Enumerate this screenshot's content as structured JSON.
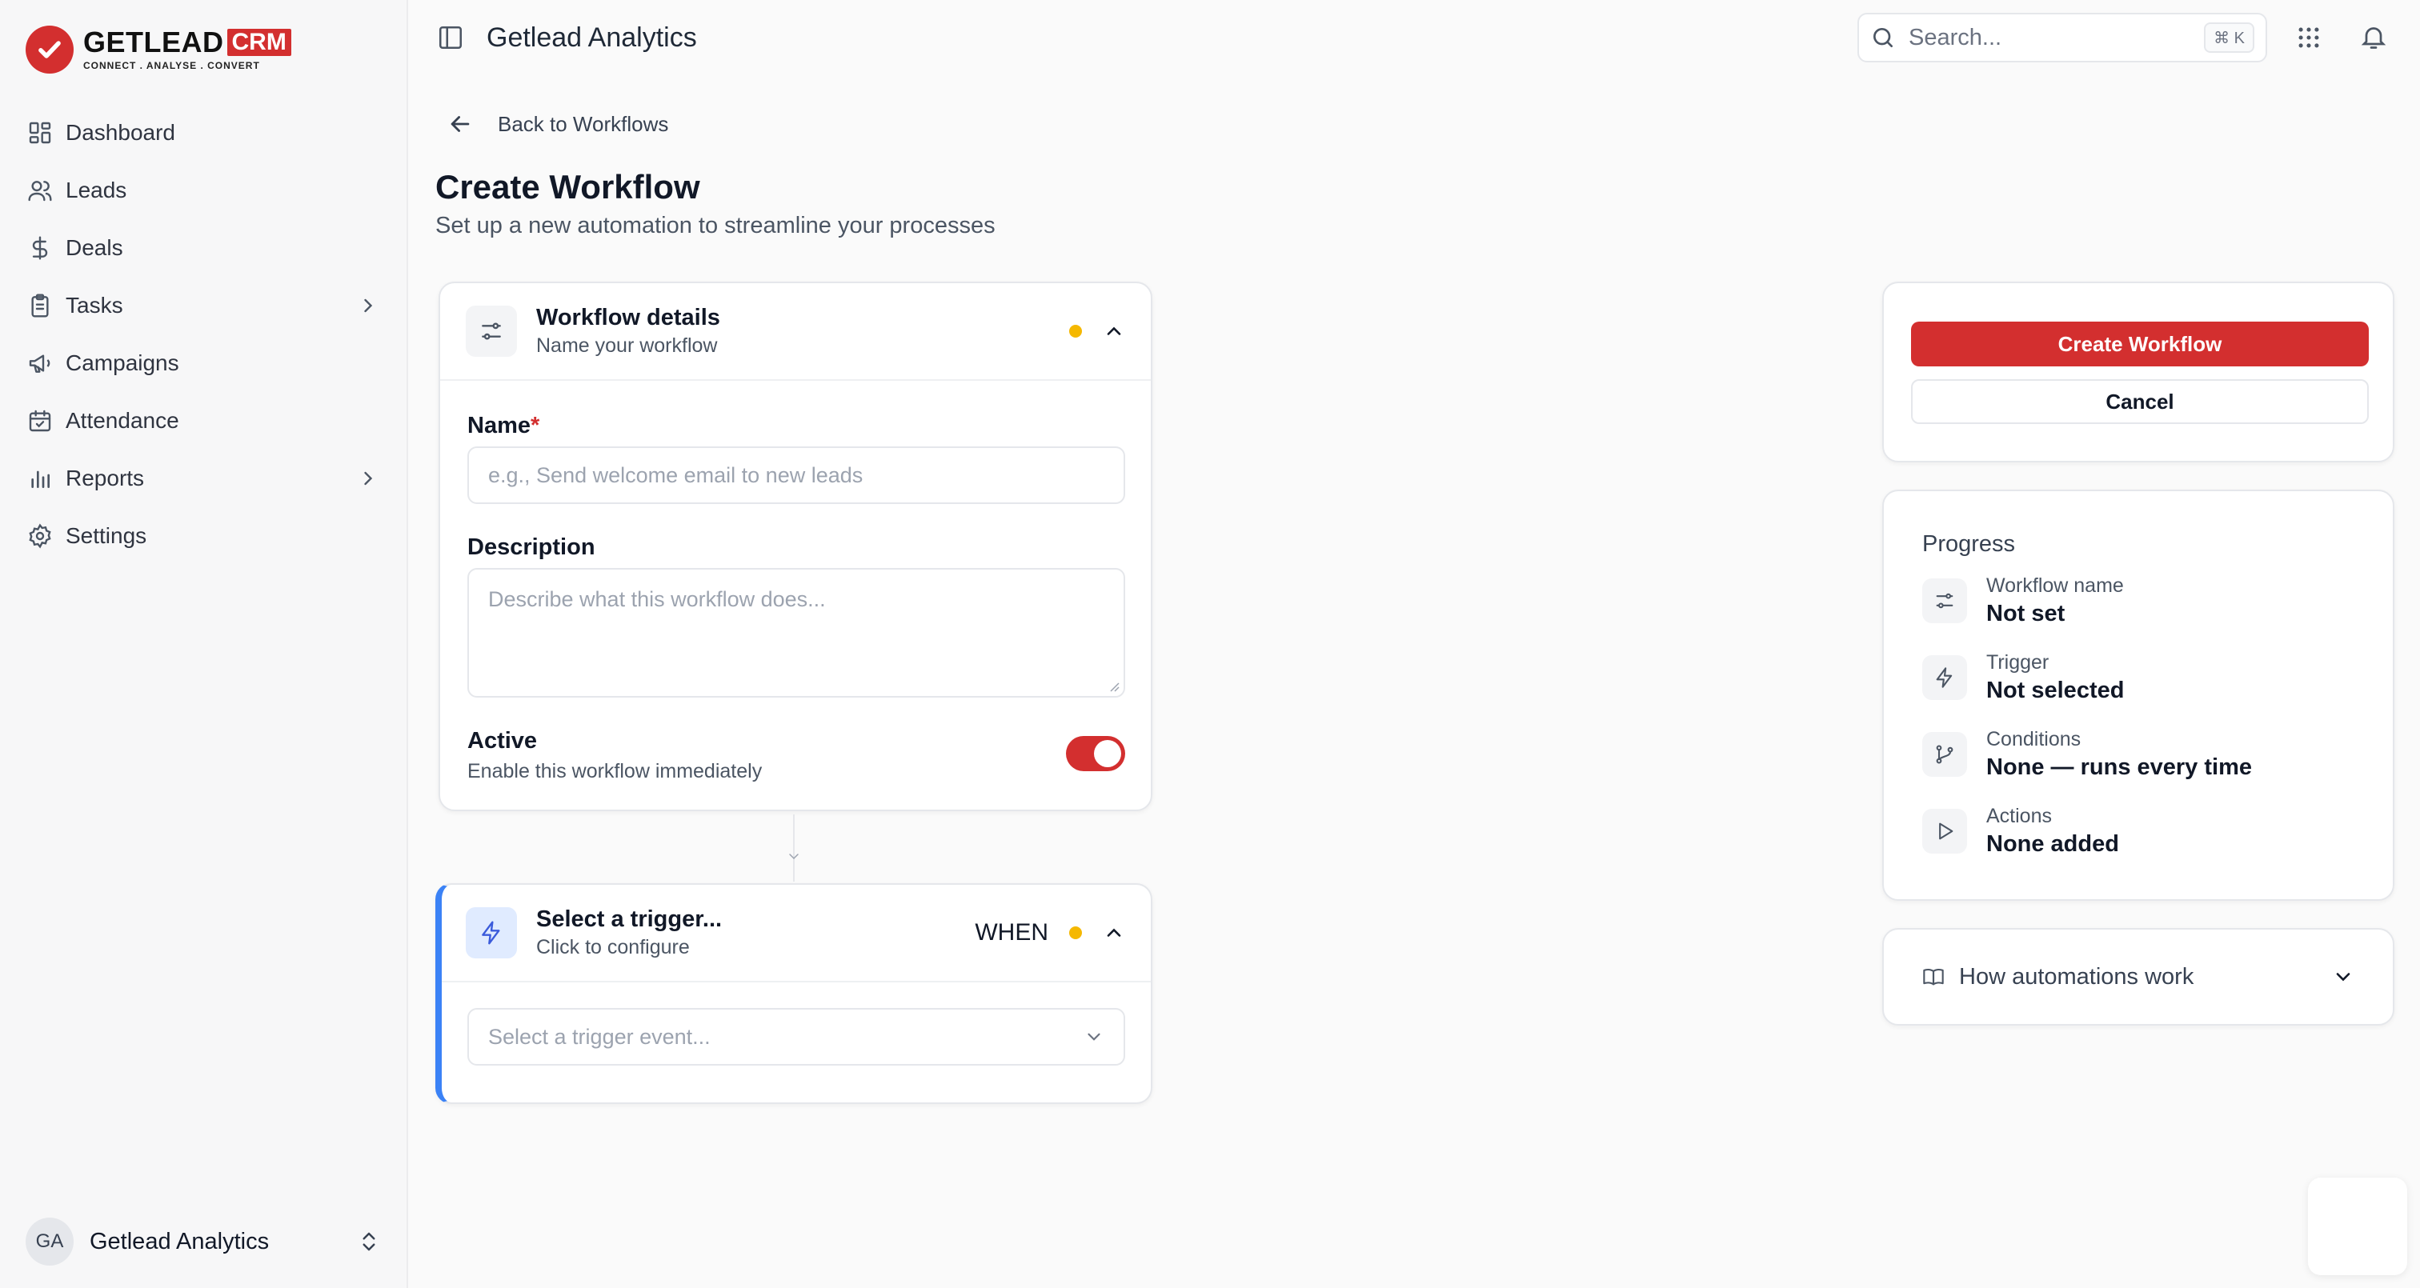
{
  "brand": {
    "name": "GETLEAD",
    "badge": "CRM",
    "tagline": "CONNECT . ANALYSE . CONVERT",
    "color": "#d32f2f"
  },
  "sidebar": {
    "items": [
      {
        "label": "Dashboard",
        "icon": "grid-icon"
      },
      {
        "label": "Leads",
        "icon": "users-icon"
      },
      {
        "label": "Deals",
        "icon": "dollar-icon"
      },
      {
        "label": "Tasks",
        "icon": "clipboard-icon",
        "expandable": true
      },
      {
        "label": "Campaigns",
        "icon": "megaphone-icon"
      },
      {
        "label": "Attendance",
        "icon": "calendar-check-icon"
      },
      {
        "label": "Reports",
        "icon": "bar-chart-icon",
        "expandable": true
      },
      {
        "label": "Settings",
        "icon": "gear-icon"
      }
    ],
    "account": {
      "initials": "GA",
      "name": "Getlead Analytics"
    }
  },
  "topbar": {
    "title": "Getlead Analytics",
    "search_placeholder": "Search...",
    "search_shortcut": "⌘ K"
  },
  "main": {
    "back_label": "Back to Workflows",
    "title": "Create Workflow",
    "subtitle": "Set up a new automation to streamline your processes",
    "details_card": {
      "title": "Workflow details",
      "subtitle": "Name your workflow",
      "name_label": "Name",
      "name_required": "*",
      "name_placeholder": "e.g., Send welcome email to new leads",
      "description_label": "Description",
      "description_placeholder": "Describe what this workflow does...",
      "active_label": "Active",
      "active_sub": "Enable this workflow immediately",
      "active_on": true
    },
    "trigger_card": {
      "title": "Select a trigger...",
      "subtitle": "Click to configure",
      "badge": "WHEN",
      "select_placeholder": "Select a trigger event...",
      "accent": "#3b82f6"
    }
  },
  "actions": {
    "create_label": "Create Workflow",
    "cancel_label": "Cancel"
  },
  "progress": {
    "title": "Progress",
    "items": [
      {
        "label": "Workflow name",
        "value": "Not set",
        "icon": "sliders-icon"
      },
      {
        "label": "Trigger",
        "value": "Not selected",
        "icon": "lightning-icon"
      },
      {
        "label": "Conditions",
        "value": "None — runs every time",
        "icon": "branch-icon"
      },
      {
        "label": "Actions",
        "value": "None added",
        "icon": "play-icon"
      }
    ]
  },
  "help": {
    "label": "How automations work"
  },
  "colors": {
    "status_dot": "#f5b800",
    "toggle_on": "#d32f2f"
  }
}
